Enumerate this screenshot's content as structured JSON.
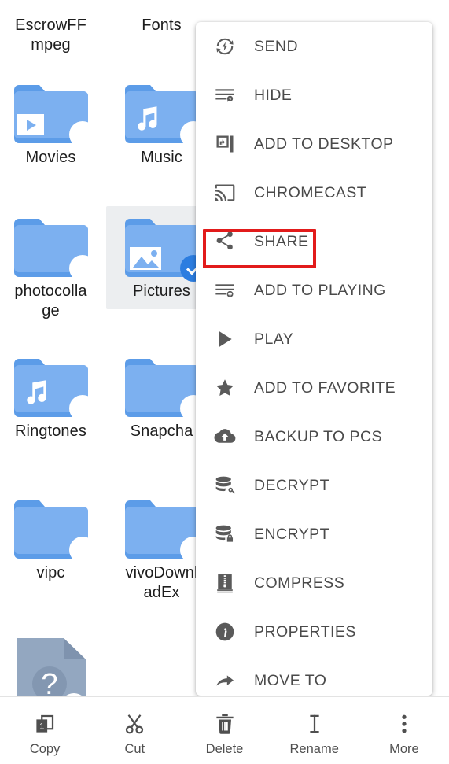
{
  "app": {
    "screen_name": "file-manager-grid-with-more-menu"
  },
  "grid": {
    "items": [
      {
        "name": "EscrowFFmpeg",
        "display": "EscrowFF\nmpeg",
        "type": "folder",
        "kind": "plain",
        "selected": false,
        "label_only": true
      },
      {
        "name": "Fonts",
        "display": "Fonts",
        "type": "folder",
        "kind": "plain",
        "selected": false,
        "label_only": true
      },
      {
        "name": "Movies",
        "display": "Movies",
        "type": "folder",
        "kind": "video",
        "selected": false
      },
      {
        "name": "Music",
        "display": "Music",
        "type": "folder",
        "kind": "audio",
        "selected": false
      },
      {
        "name": "photocollage",
        "display": "photocolla\nge",
        "type": "folder",
        "kind": "plain",
        "selected": false
      },
      {
        "name": "Pictures",
        "display": "Pictures",
        "type": "folder",
        "kind": "image",
        "selected": true
      },
      {
        "name": "Ringtones",
        "display": "Ringtones",
        "type": "folder",
        "kind": "audio",
        "selected": false
      },
      {
        "name": "Snapchat",
        "display": "Snapcha",
        "type": "folder",
        "kind": "plain",
        "selected": false
      },
      {
        "name": "vipc",
        "display": "vipc",
        "type": "folder",
        "kind": "plain",
        "selected": false
      },
      {
        "name": "vivoDownloadEx",
        "display": "vivoDownl\nadEx",
        "type": "folder",
        "kind": "plain",
        "selected": false
      },
      {
        "name": "unknown-file",
        "display": "",
        "type": "file",
        "kind": "unknown",
        "selected": false
      }
    ],
    "colors": {
      "folder_body": "#7cb0f0",
      "folder_tab": "#5c9ce8",
      "selected_background": "#eceef0",
      "check_badge": "#2c7de0",
      "unknown_file": "#93a7c0"
    }
  },
  "menu": {
    "items": [
      {
        "label": "SEND",
        "icon": "send-flash-icon"
      },
      {
        "label": "HIDE",
        "icon": "hide-lines-icon"
      },
      {
        "label": "ADD TO DESKTOP",
        "icon": "add-to-desktop-icon"
      },
      {
        "label": "CHROMECAST",
        "icon": "chromecast-icon"
      },
      {
        "label": "SHARE",
        "icon": "share-nodes-icon",
        "highlighted": true
      },
      {
        "label": "ADD TO PLAYING",
        "icon": "add-to-playlist-icon"
      },
      {
        "label": "PLAY",
        "icon": "play-triangle-icon"
      },
      {
        "label": "ADD TO FAVORITE",
        "icon": "star-icon"
      },
      {
        "label": "BACKUP TO PCS",
        "icon": "cloud-upload-icon"
      },
      {
        "label": "DECRYPT",
        "icon": "database-unlock-icon"
      },
      {
        "label": "ENCRYPT",
        "icon": "database-lock-icon"
      },
      {
        "label": "COMPRESS",
        "icon": "zip-archive-icon"
      },
      {
        "label": "PROPERTIES",
        "icon": "info-circle-icon"
      },
      {
        "label": "MOVE TO",
        "icon": "move-arrow-icon"
      }
    ],
    "highlight_color": "#e21b1b",
    "icon_color": "#5a5a5a",
    "text_color": "#4a4a4a"
  },
  "toolbar": {
    "items": [
      {
        "label": "Copy",
        "icon": "copy-icon",
        "badge": "1"
      },
      {
        "label": "Cut",
        "icon": "scissors-icon"
      },
      {
        "label": "Delete",
        "icon": "trash-icon"
      },
      {
        "label": "Rename",
        "icon": "text-cursor-icon"
      },
      {
        "label": "More",
        "icon": "overflow-dots-icon"
      }
    ]
  }
}
